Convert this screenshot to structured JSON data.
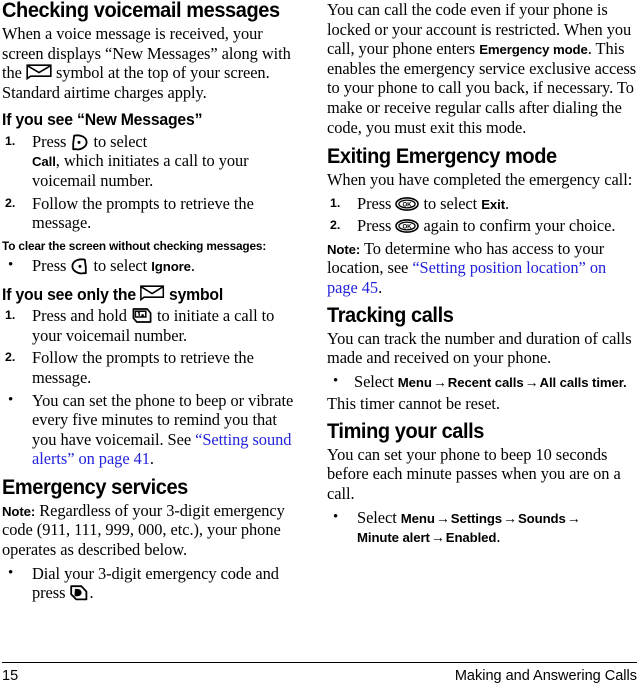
{
  "document": {
    "page_number": "15",
    "chapter_title": "Making and Answering Calls",
    "link_color": "#2222dd"
  },
  "left_column": {
    "heading_checking_voicemail": "Checking voicemail messages",
    "intro_p1a": "When a voice message is received, your screen displays “New Messages” along with the ",
    "intro_p1b": " symbol at the top of your screen. Standard airtime charges apply.",
    "heading_new_messages": "If you see “New Messages”",
    "step1_num": "1.",
    "step1_a": "Press ",
    "step1_b": " to select",
    "step1_ui": "Call",
    "step1_c": ", which initiates a call to your voicemail number.",
    "step2_num": "2.",
    "step2_text": "Follow the prompts to retrieve the message.",
    "heading_clear_screen": "To clear the screen without checking messages:",
    "bullet_ignore_a": "Press ",
    "bullet_ignore_b": " to select ",
    "bullet_ignore_ui": "Ignore",
    "bullet_ignore_c": ".",
    "heading_only_symbol_a": "If you see only the ",
    "heading_only_symbol_b": " symbol",
    "only_step1_num": "1.",
    "only_step1_a": "Press and hold ",
    "only_step1_b": " to initiate a call to your voicemail number.",
    "only_step2_num": "2.",
    "only_step2_text": "Follow the prompts to retrieve the message.",
    "bullet_beep_a": "You can set the phone to beep or vibrate every five minutes to remind you that you have voicemail. See ",
    "bullet_beep_link": "“Setting sound alerts” on page 41",
    "bullet_beep_b": ".",
    "heading_emergency_services": "Emergency services",
    "note_label": "Note:",
    "note_text": "Regardless of your 3-digit emergency code (911, 111, 999, 000, etc.), your phone operates as described below.",
    "bullet_dial_a": "Dial your 3-digit emergency code and press ",
    "bullet_dial_b": "."
  },
  "right_column": {
    "para_locked_a": "You can call the code even if your phone is locked or your account is restricted. When you call, your phone enters ",
    "para_locked_ui": "Emergency mode",
    "para_locked_b": ". This enables the emergency service exclusive access to your phone to call you back, if necessary. To make or receive regular calls after dialing the code, you must exit this mode.",
    "heading_exiting": "Exiting Emergency mode",
    "exiting_intro": "When you have completed the emergency call:",
    "exit_step1_num": "1.",
    "exit_step1_a": "Press ",
    "exit_step1_b": " to select ",
    "exit_step1_ui": "Exit",
    "exit_step1_c": ".",
    "exit_step2_num": "2.",
    "exit_step2_a": "Press ",
    "exit_step2_b": " again to confirm your choice.",
    "note_label": "Note:",
    "note_text_a": "To determine who has access to your location, see ",
    "note_link": "“Setting position location” on page 45",
    "note_text_b": ".",
    "heading_tracking": "Tracking calls",
    "tracking_para": "You can track the number and duration of calls made and received on your phone.",
    "tracking_bullet_select": "Select ",
    "tracking_m1": "Menu",
    "tracking_m2": "Recent calls",
    "tracking_m3": "All calls timer.",
    "tracking_after": "This timer cannot be reset.",
    "heading_timing": "Timing your calls",
    "timing_para": "You can set your phone to beep 10 seconds before each minute passes when you are on a call.",
    "timing_bullet_select": "Select ",
    "timing_m1": "Menu",
    "timing_m2": "Settings",
    "timing_m3": "Sounds",
    "timing_m4": "Minute alert",
    "timing_m5": "Enabled",
    "timing_period": ".",
    "arrow": "→"
  },
  "icons": {
    "envelope": "envelope-icon",
    "left_soft_key": "left-soft-key-icon",
    "right_soft_key": "right-soft-key-icon",
    "voicemail_key": "voicemail-one-key-icon",
    "send_key": "send-key-icon",
    "ok_key": "ok-key-icon"
  }
}
